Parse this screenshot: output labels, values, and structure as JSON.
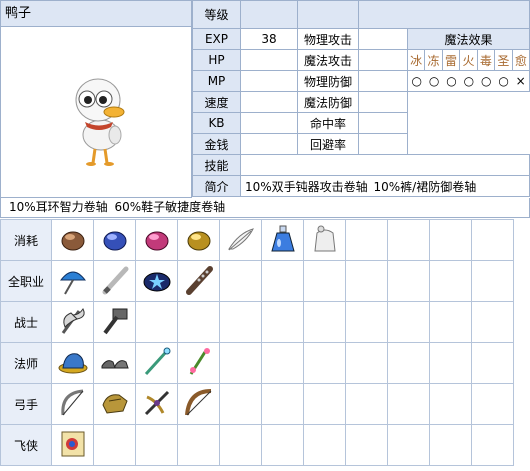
{
  "mob": {
    "name": "鸭子"
  },
  "stats": {
    "level_label": "等级",
    "exp_label": "EXP",
    "exp_value": "38",
    "hp_label": "HP",
    "mp_label": "MP",
    "speed_label": "速度",
    "kb_label": "KB",
    "money_label": "金钱",
    "skill_label": "技能",
    "intro_label": "简介",
    "phys_atk_label": "物理攻击",
    "mag_atk_label": "魔法攻击",
    "phys_def_label": "物理防御",
    "mag_def_label": "魔法防御",
    "acc_label": "命中率",
    "avoid_label": "回避率",
    "intro_text": "10%双手钝器攻击卷轴  10%裤/裙防御卷轴"
  },
  "magic": {
    "header": "魔法效果",
    "elements": [
      "冰",
      "冻",
      "雷",
      "火",
      "毒",
      "圣",
      "愈"
    ],
    "marks": [
      "○",
      "○",
      "○",
      "○",
      "○",
      "○",
      "×"
    ]
  },
  "drops_line": "10%耳环智力卷轴  60%鞋子敏捷度卷轴",
  "categories": [
    "消耗",
    "全职业",
    "战士",
    "法师",
    "弓手",
    "飞侠"
  ],
  "icons": {
    "row0": [
      "brown-ore-icon",
      "blue-ore-icon",
      "pink-ore-icon",
      "gold-ore-icon",
      "white-feather-icon",
      "blue-potion-icon",
      "white-bag-icon"
    ],
    "row1": [
      "umbrella-icon",
      "baseball-bat-icon",
      "star-bandana-icon",
      "spiked-club-icon"
    ],
    "row2": [
      "battle-axe-icon",
      "hammer-icon"
    ],
    "row3": [
      "blue-hat-icon",
      "shoes-icon",
      "wand-icon",
      "staff-icon"
    ],
    "row4": [
      "bow-icon",
      "gauntlet-icon",
      "crossbow-icon",
      "longbow-icon"
    ],
    "row5": [
      "scroll-icon"
    ]
  }
}
